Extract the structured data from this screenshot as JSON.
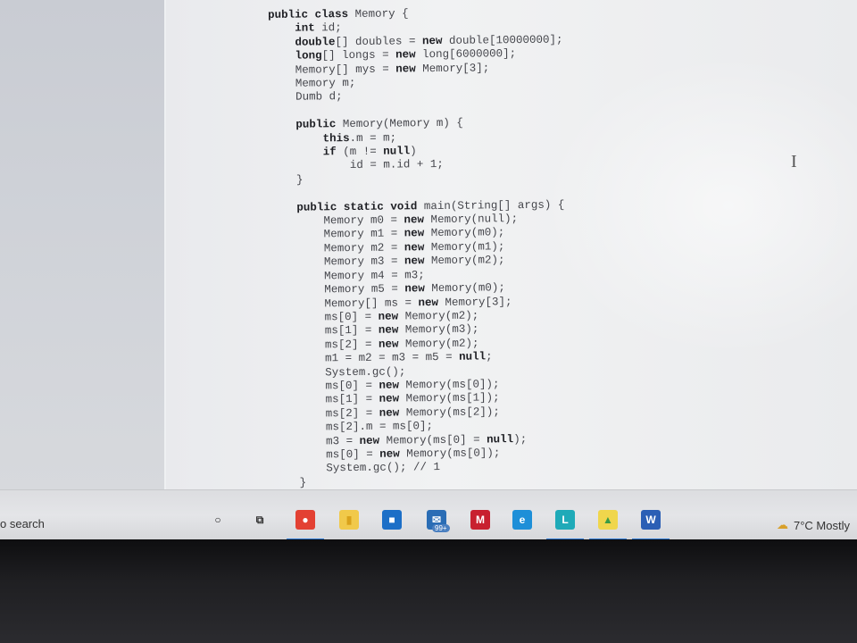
{
  "code": {
    "lines": [
      [
        {
          "t": "public class",
          "k": 1
        },
        {
          "t": " Memory {",
          "k": 0
        }
      ],
      [
        {
          "t": "    ",
          "k": 0
        },
        {
          "t": "int",
          "k": 1
        },
        {
          "t": " id;",
          "k": 0
        }
      ],
      [
        {
          "t": "    ",
          "k": 0
        },
        {
          "t": "double",
          "k": 1
        },
        {
          "t": "[] doubles = ",
          "k": 0
        },
        {
          "t": "new",
          "k": 1
        },
        {
          "t": " double[10000000];",
          "k": 0
        }
      ],
      [
        {
          "t": "    ",
          "k": 0
        },
        {
          "t": "long",
          "k": 1
        },
        {
          "t": "[] longs = ",
          "k": 0
        },
        {
          "t": "new",
          "k": 1
        },
        {
          "t": " long[6000000];",
          "k": 0
        }
      ],
      [
        {
          "t": "    Memory[] mys = ",
          "k": 0
        },
        {
          "t": "new",
          "k": 1
        },
        {
          "t": " Memory[3];",
          "k": 0
        }
      ],
      [
        {
          "t": "    Memory m;",
          "k": 0
        }
      ],
      [
        {
          "t": "    Dumb d;",
          "k": 0
        }
      ],
      [
        {
          "t": "",
          "k": 0
        }
      ],
      [
        {
          "t": "    ",
          "k": 0
        },
        {
          "t": "public",
          "k": 1
        },
        {
          "t": " Memory(Memory m) {",
          "k": 0
        }
      ],
      [
        {
          "t": "        ",
          "k": 0
        },
        {
          "t": "this",
          "k": 1
        },
        {
          "t": ".m = m;",
          "k": 0
        }
      ],
      [
        {
          "t": "        ",
          "k": 0
        },
        {
          "t": "if",
          "k": 1
        },
        {
          "t": " (m != ",
          "k": 0
        },
        {
          "t": "null",
          "k": 1
        },
        {
          "t": ")",
          "k": 0
        }
      ],
      [
        {
          "t": "            id = m.id + 1;",
          "k": 0
        }
      ],
      [
        {
          "t": "    }",
          "k": 0
        }
      ],
      [
        {
          "t": "",
          "k": 0
        }
      ],
      [
        {
          "t": "    ",
          "k": 0
        },
        {
          "t": "public static void",
          "k": 1
        },
        {
          "t": " main(String[] args) {",
          "k": 0
        }
      ],
      [
        {
          "t": "        Memory m0 = ",
          "k": 0
        },
        {
          "t": "new",
          "k": 1
        },
        {
          "t": " Memory(null);",
          "k": 0
        }
      ],
      [
        {
          "t": "        Memory m1 = ",
          "k": 0
        },
        {
          "t": "new",
          "k": 1
        },
        {
          "t": " Memory(m0);",
          "k": 0
        }
      ],
      [
        {
          "t": "        Memory m2 = ",
          "k": 0
        },
        {
          "t": "new",
          "k": 1
        },
        {
          "t": " Memory(m1);",
          "k": 0
        }
      ],
      [
        {
          "t": "        Memory m3 = ",
          "k": 0
        },
        {
          "t": "new",
          "k": 1
        },
        {
          "t": " Memory(m2);",
          "k": 0
        }
      ],
      [
        {
          "t": "        Memory m4 = m3;",
          "k": 0
        }
      ],
      [
        {
          "t": "        Memory m5 = ",
          "k": 0
        },
        {
          "t": "new",
          "k": 1
        },
        {
          "t": " Memory(m0);",
          "k": 0
        }
      ],
      [
        {
          "t": "        Memory[] ms = ",
          "k": 0
        },
        {
          "t": "new",
          "k": 1
        },
        {
          "t": " Memory[3];",
          "k": 0
        }
      ],
      [
        {
          "t": "        ms[0] = ",
          "k": 0
        },
        {
          "t": "new",
          "k": 1
        },
        {
          "t": " Memory(m2);",
          "k": 0
        }
      ],
      [
        {
          "t": "        ms[1] = ",
          "k": 0
        },
        {
          "t": "new",
          "k": 1
        },
        {
          "t": " Memory(m3);",
          "k": 0
        }
      ],
      [
        {
          "t": "        ms[2] = ",
          "k": 0
        },
        {
          "t": "new",
          "k": 1
        },
        {
          "t": " Memory(m2);",
          "k": 0
        }
      ],
      [
        {
          "t": "        m1 = m2 = m3 = m5 = ",
          "k": 0
        },
        {
          "t": "null",
          "k": 1
        },
        {
          "t": ";",
          "k": 0
        }
      ],
      [
        {
          "t": "        System.gc();",
          "k": 0
        }
      ],
      [
        {
          "t": "        ms[0] = ",
          "k": 0
        },
        {
          "t": "new",
          "k": 1
        },
        {
          "t": " Memory(ms[0]);",
          "k": 0
        }
      ],
      [
        {
          "t": "        ms[1] = ",
          "k": 0
        },
        {
          "t": "new",
          "k": 1
        },
        {
          "t": " Memory(ms[1]);",
          "k": 0
        }
      ],
      [
        {
          "t": "        ms[2] = ",
          "k": 0
        },
        {
          "t": "new",
          "k": 1
        },
        {
          "t": " Memory(ms[2]);",
          "k": 0
        }
      ],
      [
        {
          "t": "        ms[2].m = ms[0];",
          "k": 0
        }
      ],
      [
        {
          "t": "        m3 = ",
          "k": 0
        },
        {
          "t": "new",
          "k": 1
        },
        {
          "t": " Memory(ms[0] = ",
          "k": 0
        },
        {
          "t": "null",
          "k": 1
        },
        {
          "t": ");",
          "k": 0
        }
      ],
      [
        {
          "t": "        ms[0] = ",
          "k": 0
        },
        {
          "t": "new",
          "k": 1
        },
        {
          "t": " Memory(ms[0]);",
          "k": 0
        }
      ],
      [
        {
          "t": "        System.gc(); // 1",
          "k": 0
        }
      ],
      [
        {
          "t": "    }",
          "k": 0
        }
      ]
    ]
  },
  "cursor": {
    "glyph": "I"
  },
  "taskbar": {
    "search_text": "o search",
    "icons": [
      {
        "name": "cortana-icon",
        "glyph": "○",
        "color": "#222222",
        "bg": "transparent"
      },
      {
        "name": "task-view-icon",
        "glyph": "⧉",
        "color": "#333333",
        "bg": "transparent"
      },
      {
        "name": "chrome-icon",
        "glyph": "●",
        "color": "#ffffff",
        "bg": "#e34133"
      },
      {
        "name": "file-explorer-icon",
        "glyph": "▮",
        "color": "#d9a21b",
        "bg": "#f1c94a"
      },
      {
        "name": "store-icon",
        "glyph": "■",
        "color": "#ffffff",
        "bg": "#1c6fc7"
      },
      {
        "name": "mail-icon",
        "glyph": "✉",
        "color": "#ffffff",
        "bg": "#2a6db5",
        "badge": "99+"
      },
      {
        "name": "mcafee-icon",
        "glyph": "M",
        "color": "#ffffff",
        "bg": "#c8202f"
      },
      {
        "name": "edge-icon",
        "glyph": "e",
        "color": "#ffffff",
        "bg": "#1e8fd8"
      },
      {
        "name": "launcher-l-icon",
        "glyph": "L",
        "color": "#ffffff",
        "bg": "#1faab8"
      },
      {
        "name": "chart-app-icon",
        "glyph": "▲",
        "color": "#3a9b45",
        "bg": "#f0d64c"
      },
      {
        "name": "word-icon",
        "glyph": "W",
        "color": "#ffffff",
        "bg": "#2b5fb5"
      }
    ],
    "weather": "7°C  Mostly",
    "accent": "#2b79d6"
  }
}
